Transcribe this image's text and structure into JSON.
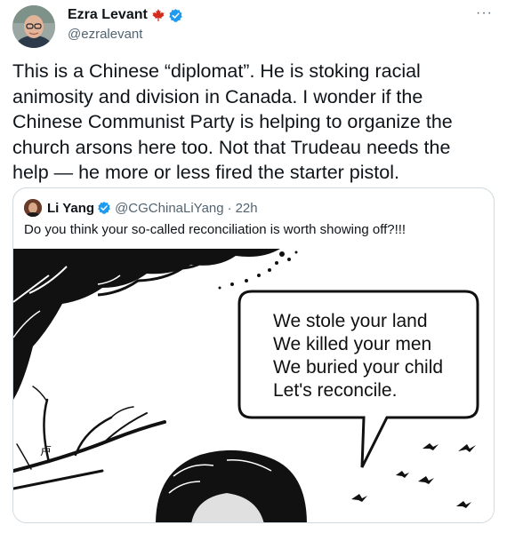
{
  "author": {
    "display_name": "Ezra Levant",
    "handle": "@ezralevant",
    "flag_icon": "maple-leaf-icon",
    "verified_icon": "verified-badge-icon",
    "verified_color": "#1d9bf0"
  },
  "more_label": "···",
  "body_lines": [
    "This is a Chinese “diplomat”. He is stoking racial",
    "animosity and division in Canada. I wonder if the",
    "Chinese Communist Party is helping to organize the",
    "church arsons here too. Not that Trudeau needs the",
    "help — he more or less fired the starter pistol."
  ],
  "quoted": {
    "display_name": "Li Yang",
    "handle": "@CGChinaLiYang",
    "separator": "·",
    "time": "22h",
    "text": "Do you think your so-called reconciliation is worth showing off?!!!",
    "image": {
      "speech_lines": [
        "We stole your land",
        "We killed your men",
        "We buried your child",
        "Let's reconcile."
      ]
    }
  },
  "colors": {
    "text": "#0f1419",
    "secondary": "#536471",
    "border": "#cfd9de",
    "flag_red": "#d52b1e"
  }
}
